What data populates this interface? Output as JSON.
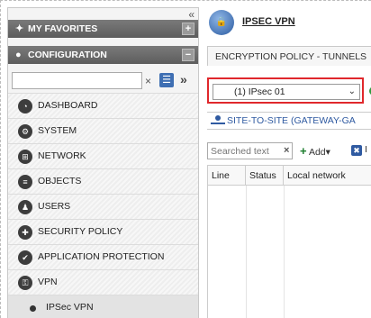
{
  "sidebar": {
    "collapse_label": "«",
    "favorites_label": "MY FAVORITES",
    "favorites_toggle": "+",
    "configuration_label": "CONFIGURATION",
    "configuration_toggle": "−",
    "search": {
      "value": "",
      "placeholder": ""
    },
    "clear_label": "×",
    "expand_label": "»",
    "items": [
      {
        "label": "DASHBOARD",
        "icon": "dashboard-icon"
      },
      {
        "label": "SYSTEM",
        "icon": "system-icon"
      },
      {
        "label": "NETWORK",
        "icon": "network-icon"
      },
      {
        "label": "OBJECTS",
        "icon": "objects-icon"
      },
      {
        "label": "USERS",
        "icon": "users-icon"
      },
      {
        "label": "SECURITY POLICY",
        "icon": "security-policy-icon"
      },
      {
        "label": "APPLICATION PROTECTION",
        "icon": "application-protection-icon"
      },
      {
        "label": "VPN",
        "icon": "vpn-icon"
      }
    ],
    "subitem": {
      "label": "IPSec VPN"
    }
  },
  "main": {
    "app_title": "IPSEC VPN",
    "tab_label": "ENCRYPTION POLICY - TUNNELS",
    "policy_select": {
      "value": "(1) IPsec 01"
    },
    "section_label": "SITE-TO-SITE (GATEWAY-GA",
    "toolbar": {
      "search_placeholder": "Searched text",
      "clear_label": "×",
      "add_label": "Add",
      "delete_partial": "I"
    },
    "grid_columns": [
      "Line",
      "Status",
      "Local network"
    ]
  },
  "colors": {
    "highlight": "#e0282c",
    "link": "#2f5aa1",
    "header": "#666666"
  }
}
